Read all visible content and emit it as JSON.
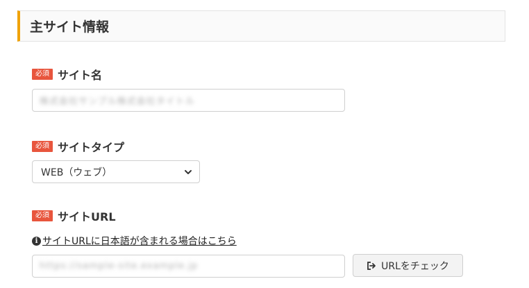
{
  "section": {
    "title": "主サイト情報"
  },
  "required_badge": "必須",
  "site_name": {
    "label": "サイト名",
    "value": "株式会社サンプル株式会社タイトル"
  },
  "site_type": {
    "label": "サイトタイプ",
    "selected": "WEB（ウェブ）"
  },
  "site_url": {
    "label": "サイトURL",
    "help_link": "サイトURLに日本語が含まれる場合はこちら",
    "value": "https://sample-site.example.jp",
    "check_button": "URLをチェック"
  }
}
